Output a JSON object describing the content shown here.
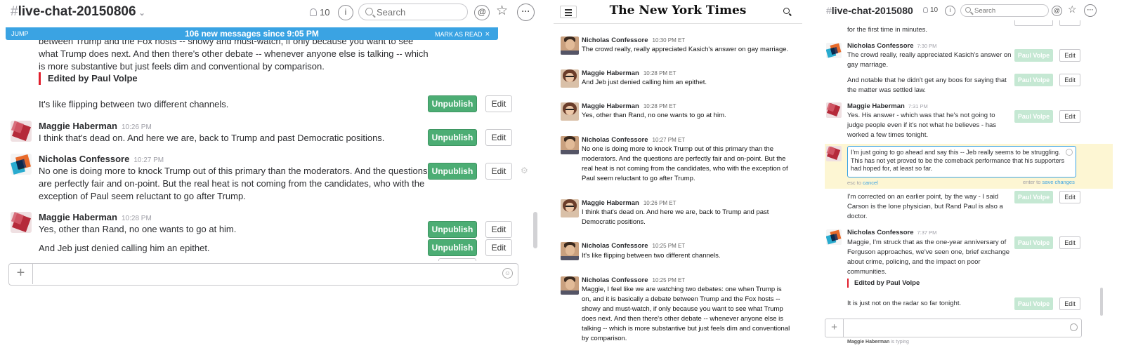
{
  "left": {
    "channel_hash": "#",
    "channel_name": "live-chat-20150806",
    "caret": "⌄",
    "member_count": "10",
    "info_icon": "i",
    "search_placeholder": "Search",
    "at_icon": "@",
    "star_icon": "☆",
    "more_icon": "···",
    "new_bar": {
      "jump": "JUMP",
      "message": "106 new messages since 9:05 PM",
      "mark_read": "MARK AS READ",
      "close": "×"
    },
    "messages": [
      {
        "text": "between Trump and the Fox hosts -- showy and must-watch, if only because you want to see what Trump does next. And then there's other debate -- whenever anyone else is talking -- which is more substantive but just feels dim and conventional by comparison."
      },
      {
        "edited": "Edited by Paul Volpe"
      },
      {
        "text": "It's like flipping between two different channels."
      },
      {
        "author": "Maggie Haberman",
        "time": "10:26 PM",
        "text": "I think that's dead on. And here we are, back to Trump and past Democratic positions."
      },
      {
        "author": "Nicholas Confessore",
        "time": "10:27 PM",
        "text": "No one is doing more to knock Trump out of this primary than the moderators. And the questions are perfectly fair and on-point. But the real heat is not coming from the candidates, who with the exception of Paul seem reluctant to go after Trump."
      },
      {
        "author": "Maggie Haberman",
        "time": "10:28 PM",
        "text": "Yes, other than Rand, no one wants to go at him."
      },
      {
        "text": "And Jeb just denied calling him an epithet."
      }
    ],
    "unpublish_label": "Unpublish",
    "edit_label": "Edit",
    "plus": "+",
    "smile": "☺"
  },
  "mid": {
    "logo": "The New York Times",
    "messages": [
      {
        "author": "Nicholas Confessore",
        "time": "10:30 PM ET",
        "text": "The crowd really, really appreciated Kasich's answer on gay marriage."
      },
      {
        "author": "Maggie Haberman",
        "time": "10:28 PM ET",
        "text": "And Jeb just denied calling him an epithet."
      },
      {
        "author": "Maggie Haberman",
        "time": "10:28 PM ET",
        "text": "Yes, other than Rand, no one wants to go at him."
      },
      {
        "author": "Nicholas Confessore",
        "time": "10:27 PM ET",
        "text": "No one is doing more to knock Trump out of this primary than the moderators. And the questions are perfectly fair and on-point. But the real heat is not coming from the candidates, who with the exception of Paul seem reluctant to go after Trump."
      },
      {
        "author": "Maggie Haberman",
        "time": "10:26 PM ET",
        "text": "I think that's dead on. And here we are, back to Trump and past Democratic positions."
      },
      {
        "author": "Nicholas Confessore",
        "time": "10:25 PM ET",
        "text": "It's like flipping between two different channels."
      },
      {
        "author": "Nicholas Confessore",
        "time": "10:25 PM ET",
        "text": "Maggie, I feel like we are watching two debates: one when Trump is on, and it is basically a debate between Trump and the Fox hosts -- showy and must-watch, if only because you want to see what Trump does next. And then there's other debate -- whenever anyone else is talking -- which is more substantive but just feels dim and conventional by comparison."
      }
    ]
  },
  "right": {
    "channel_hash": "#",
    "channel_name": "live-chat-2015080",
    "member_count": "10",
    "info_icon": "i",
    "search_placeholder": "Search",
    "at_icon": "@",
    "star_icon": "☆",
    "more_icon": "···",
    "messages": [
      {
        "text": "for the first time in minutes."
      },
      {
        "author": "Nicholas Confessore",
        "time": "7:30 PM",
        "text": "The crowd really, really appreciated Kasich's answer on gay marriage."
      },
      {
        "text": "And notable that he didn't get any boos for saying that the matter was settled law."
      },
      {
        "author": "Maggie Haberman",
        "time": "7:31 PM",
        "text": "Yes. His answer - which was that he's not going to judge people even if it's not what he believes - has worked a few times tonight."
      },
      {
        "text": "I'm corrected on an earlier point, by the way - I said Carson is the lone physician, but Rand Paul is also a doctor."
      },
      {
        "author": "Nicholas Confessore",
        "time": "7:37 PM",
        "text": "Maggie, I'm struck that as the one-year anniversary of Ferguson approaches, we've seen one, brief exchange about crime, policing, and the impact on poor communities."
      },
      {
        "edited": "Edited by Paul Volpe"
      },
      {
        "text": "It is just not on the radar so far tonight."
      }
    ],
    "edit_box_text": "I'm just going to go ahead and say this -- Jeb really seems to be struggling. This has not yet proved to be the comeback performance that his supporters had hoped for, at least so far.",
    "esc_hint_prefix": "esc to",
    "esc_hint_link": "cancel",
    "enter_hint_prefix": "enter to",
    "enter_hint_link": "save changes",
    "publish_label": "Paul Volpe",
    "edit_label": "Edit",
    "plus": "+",
    "typing_name": "Maggie Haberman",
    "typing_suffix": "is typing"
  },
  "colors": {
    "accent_blue": "#3aa3e3",
    "unpublish_green": "#4cad74",
    "published_green_light": "#c5e8d3",
    "edited_red": "#e01e2c",
    "editing_highlight": "#fdf6d3"
  }
}
